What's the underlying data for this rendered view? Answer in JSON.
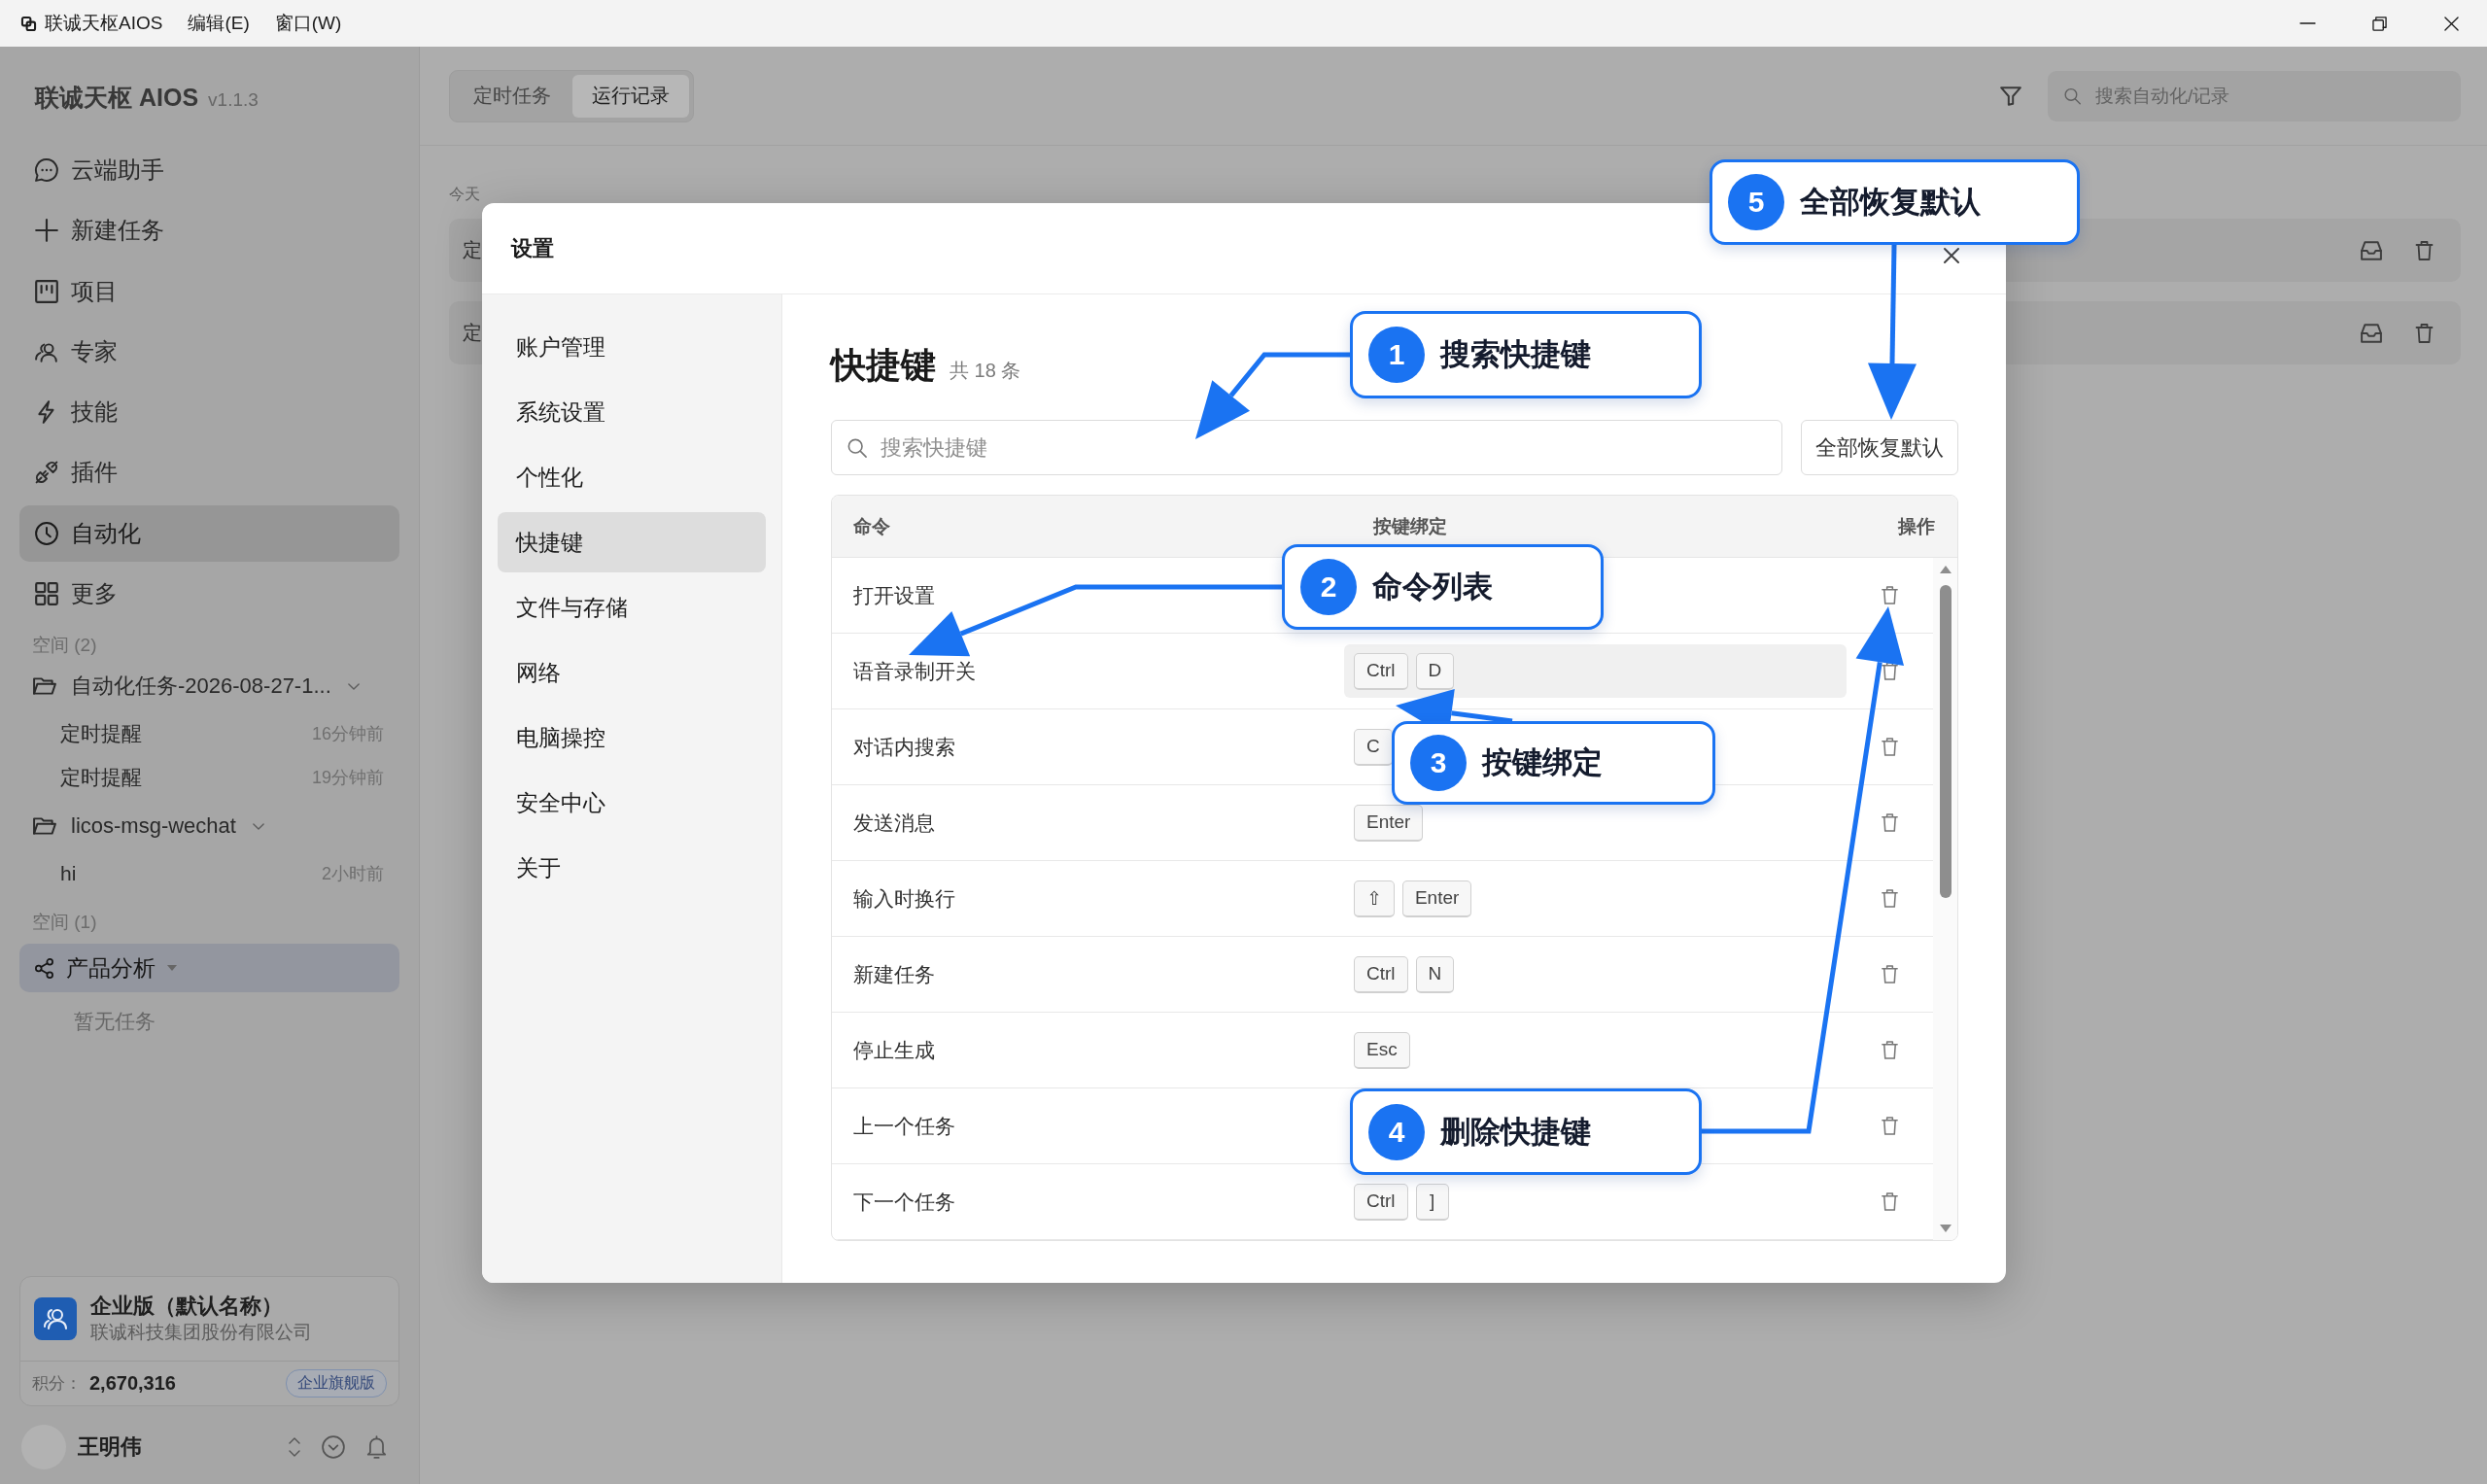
{
  "title_bar": {
    "app_name": "联诚天枢AIOS",
    "menus": [
      "编辑(E)",
      "窗口(W)"
    ]
  },
  "sidebar": {
    "brand": "联诚天枢 AIOS",
    "version": "v1.1.3",
    "nav": [
      {
        "label": "云端助手",
        "selected": false
      },
      {
        "label": "新建任务",
        "selected": false
      },
      {
        "label": "项目",
        "selected": false
      },
      {
        "label": "专家",
        "selected": false
      },
      {
        "label": "技能",
        "selected": false
      },
      {
        "label": "插件",
        "selected": false
      },
      {
        "label": "自动化",
        "selected": true
      },
      {
        "label": "更多",
        "selected": false
      }
    ],
    "space_groups": [
      {
        "kind": "folders",
        "heading": "空间 (2)",
        "folders": [
          {
            "name": "自动化任务-2026-08-27-1...",
            "expanded": true,
            "tasks": [
              {
                "title": "定时提醒",
                "time": "16分钟前"
              },
              {
                "title": "定时提醒",
                "time": "19分钟前"
              }
            ]
          },
          {
            "name": "licos-msg-wechat",
            "expanded": true,
            "tasks": [
              {
                "title": "hi",
                "time": "2小时前"
              }
            ]
          }
        ]
      },
      {
        "kind": "project",
        "heading": "空间 (1)",
        "project": {
          "name": "产品分析",
          "selected": true,
          "empty_text": "暂无任务"
        }
      }
    ],
    "org_card": {
      "plan": "企业版（默认名称）",
      "company": "联诚科技集团股份有限公司",
      "points_label": "积分：",
      "points": "2,670,316",
      "badge": "企业旗舰版"
    },
    "user": {
      "name": "王明伟"
    }
  },
  "main": {
    "tabs": [
      {
        "label": "定时任务",
        "selected": false
      },
      {
        "label": "运行记录",
        "selected": true
      }
    ],
    "search": {
      "placeholder": "搜索自动化/记录"
    },
    "day_label": "今天",
    "records": [
      {
        "title": "定"
      },
      {
        "title": "定"
      }
    ]
  },
  "settings_dialog": {
    "title": "设置",
    "nav": [
      {
        "label": "账户管理",
        "selected": false
      },
      {
        "label": "系统设置",
        "selected": false
      },
      {
        "label": "个性化",
        "selected": false
      },
      {
        "label": "快捷键",
        "selected": true
      },
      {
        "label": "文件与存储",
        "selected": false
      },
      {
        "label": "网络",
        "selected": false
      },
      {
        "label": "电脑操控",
        "selected": false
      },
      {
        "label": "安全中心",
        "selected": false
      },
      {
        "label": "关于",
        "selected": false
      }
    ],
    "section": {
      "title": "快捷键",
      "count": "共 18 条"
    },
    "search": {
      "placeholder": "搜索快捷键"
    },
    "reset_button": "全部恢复默认",
    "table": {
      "columns": [
        "命令",
        "按键绑定",
        "操作"
      ],
      "rows": [
        {
          "command": "打开设置",
          "highlighted": false
        },
        {
          "command": "语音录制开关",
          "keys": [
            "Ctrl",
            "D"
          ],
          "highlighted": true
        },
        {
          "command": "对话内搜索",
          "keys": [
            "C"
          ],
          "highlighted": false
        },
        {
          "command": "发送消息",
          "keys": [
            "Enter"
          ],
          "highlighted": false
        },
        {
          "command": "输入时换行",
          "keys": [
            "⇧",
            "Enter"
          ],
          "highlighted": false
        },
        {
          "command": "新建任务",
          "keys": [
            "Ctrl",
            "N"
          ],
          "highlighted": false
        },
        {
          "command": "停止生成",
          "keys": [
            "Esc"
          ],
          "highlighted": false
        },
        {
          "command": "上一个任务",
          "highlighted": false
        },
        {
          "command": "下一个任务",
          "keys": [
            "Ctrl",
            "]"
          ],
          "highlighted": false
        }
      ]
    }
  },
  "callouts": [
    {
      "number": "1",
      "text": "搜索快捷键"
    },
    {
      "number": "2",
      "text": "命令列表"
    },
    {
      "number": "3",
      "text": "按键绑定"
    },
    {
      "number": "4",
      "text": "删除快捷键"
    },
    {
      "number": "5",
      "text": "全部恢复默认"
    }
  ]
}
